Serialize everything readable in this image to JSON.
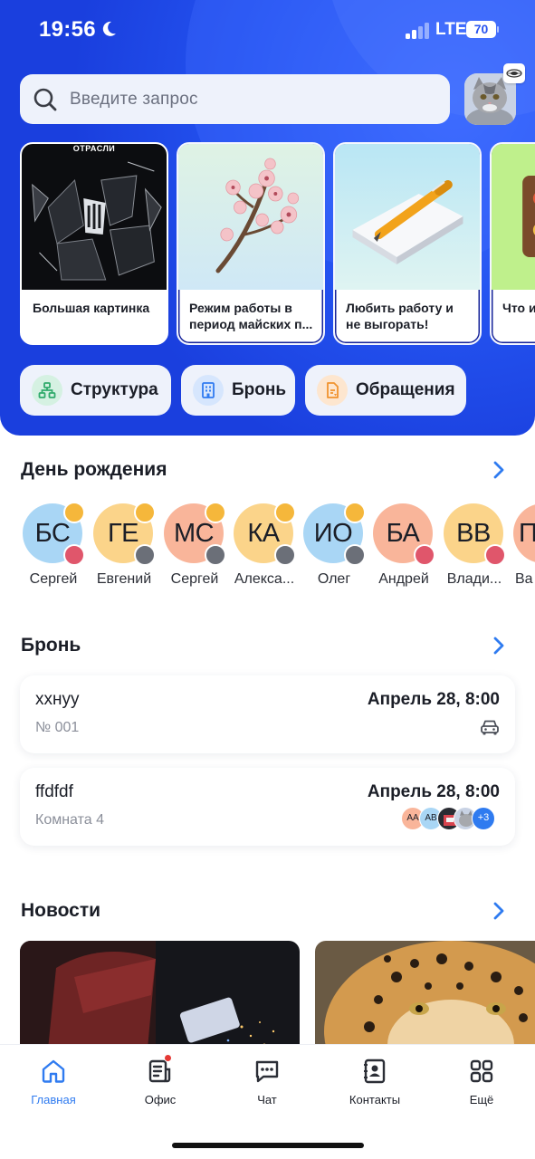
{
  "status_bar": {
    "time": "19:56",
    "network": "LTE",
    "battery": "70"
  },
  "search": {
    "placeholder": "Введите запрос"
  },
  "stories": [
    {
      "kicker": "ОТРАСЛИ",
      "title": "Большая картинка"
    },
    {
      "title": "Режим работы в период майских п..."
    },
    {
      "title": "Любить работу и не выгорать!"
    },
    {
      "title": "Что и на ра"
    }
  ],
  "quick_actions": [
    {
      "label": "Структура",
      "icon": "structure-icon",
      "color": "#2faa6b"
    },
    {
      "label": "Бронь",
      "icon": "building-icon",
      "color": "#2f7bf0"
    },
    {
      "label": "Обращения",
      "icon": "document-icon",
      "color": "#f0932f"
    }
  ],
  "birthdays": {
    "title": "День рождения",
    "items": [
      {
        "initials": "БС",
        "name": "Сергей",
        "bg": "#a9d6f5",
        "cake": "#e0566b"
      },
      {
        "initials": "ГЕ",
        "name": "Евгений",
        "bg": "#fbd48a",
        "cake": "#6b6f78"
      },
      {
        "initials": "МС",
        "name": "Сергей",
        "bg": "#f9b59a",
        "cake": "#6b6f78"
      },
      {
        "initials": "КА",
        "name": "Алекса...",
        "bg": "#fbd48a",
        "cake": "#6b6f78"
      },
      {
        "initials": "ИО",
        "name": "Олег",
        "bg": "#a9d6f5",
        "cake": "#6b6f78"
      },
      {
        "initials": "БА",
        "name": "Андрей",
        "bg": "#f9b59a",
        "cake": "#e0566b"
      },
      {
        "initials": "ВВ",
        "name": "Влади...",
        "bg": "#fbd48a",
        "cake": "#e0566b"
      },
      {
        "initials": "П",
        "name": "Ва",
        "bg": "#f9b59a",
        "cake": "#6b6f78"
      }
    ]
  },
  "booking": {
    "title": "Бронь",
    "items": [
      {
        "name": "xxнуу",
        "date": "Апрель 28, 8:00",
        "sub": "№ 001",
        "kind": "car"
      },
      {
        "name": "ffdfdf",
        "date": "Апрель 28, 8:00",
        "sub": "Комната 4",
        "kind": "room",
        "people": [
          "АА",
          "АВ"
        ],
        "more": "+3"
      }
    ]
  },
  "news": {
    "title": "Новости"
  },
  "tabbar": [
    {
      "label": "Главная",
      "icon": "home-icon",
      "active": true
    },
    {
      "label": "Офис",
      "icon": "office-icon",
      "active": false
    },
    {
      "label": "Чат",
      "icon": "chat-icon",
      "active": false
    },
    {
      "label": "Контакты",
      "icon": "contacts-icon",
      "active": false
    },
    {
      "label": "Ещё",
      "icon": "grid-icon",
      "active": false
    }
  ],
  "colors": {
    "accent": "#2f7bf0",
    "hero": "#2453f0"
  }
}
